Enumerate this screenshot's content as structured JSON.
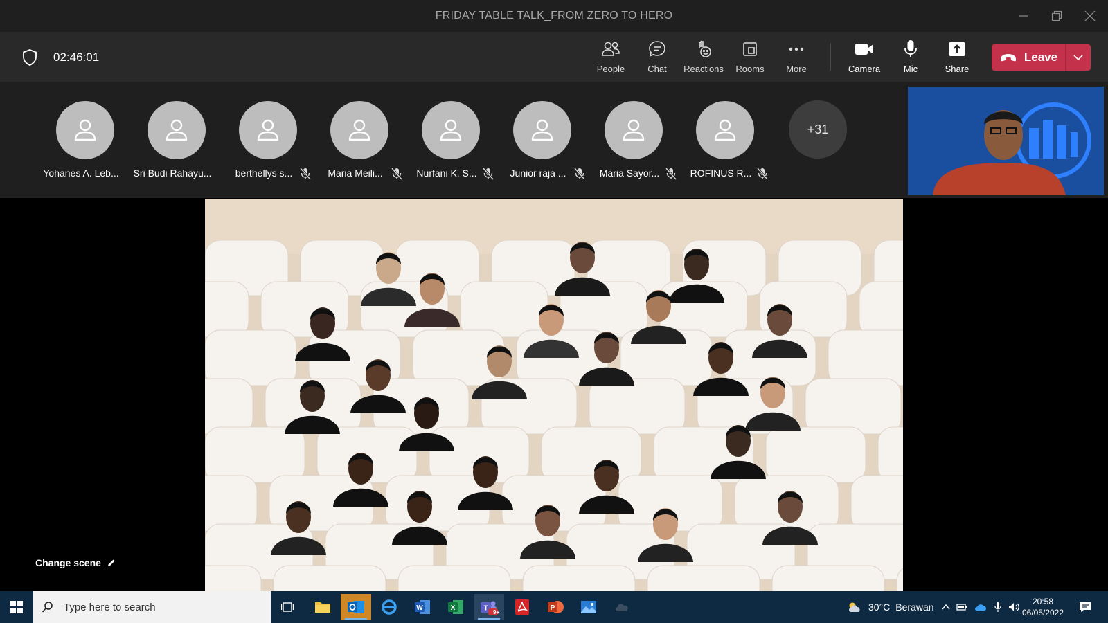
{
  "window": {
    "title": "FRIDAY TABLE TALK_FROM ZERO TO HERO"
  },
  "meeting": {
    "elapsed": "02:46:01"
  },
  "toolbar": {
    "people": "People",
    "chat": "Chat",
    "reactions": "Reactions",
    "rooms": "Rooms",
    "more": "More",
    "camera": "Camera",
    "mic": "Mic",
    "share": "Share",
    "leave": "Leave"
  },
  "participants": [
    {
      "name": "Yohanes A. Leb...",
      "muted": false
    },
    {
      "name": "Sri Budi Rahayu...",
      "muted": false
    },
    {
      "name": "berthellys s...",
      "muted": true
    },
    {
      "name": "Maria Meili...",
      "muted": true
    },
    {
      "name": "Nurfani K. S...",
      "muted": true
    },
    {
      "name": "Junior raja ...",
      "muted": true
    },
    {
      "name": "Maria Sayor...",
      "muted": true
    },
    {
      "name": "ROFINUS R...",
      "muted": true
    }
  ],
  "overflow_count": "+31",
  "stage": {
    "change_scene": "Change scene"
  },
  "taskbar": {
    "search_placeholder": "Type here to search",
    "teams_badge": "9+",
    "weather_temp": "30°C",
    "weather_text": "Berawan",
    "time": "20:58",
    "date": "06/05/2022"
  },
  "colors": {
    "leave": "#c4314b",
    "selfview_bg": "#1a4fa0",
    "taskbar": "#0e2a42"
  }
}
